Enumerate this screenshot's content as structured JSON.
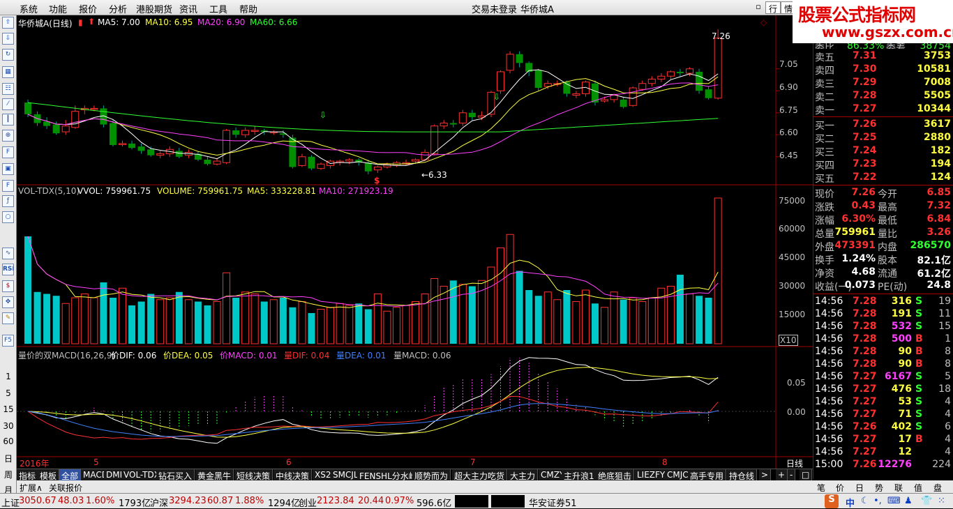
{
  "menu": {
    "items": [
      "系统",
      "功能",
      "报价",
      "分析",
      "港股期货",
      "资讯",
      "工具",
      "帮助"
    ],
    "center_status": "交易未登录",
    "center_stock": "华侨城A",
    "tab_hang": "行",
    "tab_qing": "情"
  },
  "logo": {
    "line1": "股票公式指标网",
    "line2": "www.gszx.com.cn"
  },
  "left_tools": {
    "icon_names": [
      "arrow-up-icon",
      "arrow-down-icon",
      "refresh-icon",
      "grid-icon",
      "table-icon",
      "line-chart-icon",
      "kline-icon",
      "zoom-icon",
      "fio-icon",
      "image-icon",
      "f10-icon",
      "f-lambda-icon",
      "circle-icon",
      "wave-icon",
      "rsi-icon",
      "dollar-icon",
      "move-icon",
      "pencil-icon",
      "f5-icon"
    ],
    "rsi_label": "RSI",
    "f5_label": "F5",
    "periods": [
      "1",
      "5",
      "15",
      "30",
      "60",
      "日",
      "周",
      "月"
    ]
  },
  "main_panel": {
    "stock_label": "华侨城A(日线)",
    "ma5": "MA5: 7.00",
    "ma10": "MA10: 6.95",
    "ma20": "MA20: 6.90",
    "ma60": "MA60: 6.66",
    "y_ticks": [
      "7.05",
      "6.90",
      "6.75",
      "6.60",
      "6.45"
    ],
    "high_mark": "7.26",
    "low_mark": "←6.33",
    "dollar_mark": "$"
  },
  "vol_panel": {
    "label": "VOL-TDX(5,10)",
    "vvol": "VVOL: 759961.75",
    "volume": "VOLUME: 759961.75",
    "ma5": "MA5: 333228.81",
    "ma10": "MA10: 271923.19",
    "y_ticks": [
      "75000",
      "60000",
      "45000",
      "30000",
      "15000"
    ],
    "unit": "X10"
  },
  "macd_panel": {
    "label": "量价的双MACD(16,26,9)",
    "dif": "价DIF: 0.06",
    "dea": "价DEA: 0.05",
    "macd": "价MACD: 0.01",
    "qdif": "量DIF: 0.04",
    "qdea": "量DEA: 0.01",
    "qmacd": "量MACD: 0.06",
    "y_ticks": [
      "0.05",
      "0.00"
    ]
  },
  "time_axis": {
    "year": "2016年",
    "months": [
      "5",
      "6",
      "7",
      "8"
    ],
    "period": "日线"
  },
  "bottom_tabs": [
    "指标",
    "模板",
    "全部",
    "MACD",
    "DMI",
    "VOL-TDX",
    "钻石买入",
    "黄金黑牛",
    "短线决策",
    "中线决策",
    "XS2",
    "SMCJL",
    "FENSHL分水岭",
    "顺势而为",
    "超大主力吃货",
    "大主力",
    "CMZY",
    "主升浪1",
    "绝底狙击",
    "LIEZFY",
    "CMJC",
    "高手专用",
    "持仓线"
  ],
  "bottom_tab_more": ">",
  "bottom_tab_controls": [
    "+",
    "-",
    "□"
  ],
  "tabs2": [
    "扩展∧",
    "关联报价"
  ],
  "right": {
    "partial_row": {
      "a": "委比",
      "b": "86.33%",
      "c": "委差",
      "d": "38754"
    },
    "asks": [
      {
        "label": "卖五",
        "price": "7.31",
        "vol": "3753"
      },
      {
        "label": "卖四",
        "price": "7.30",
        "vol": "10581"
      },
      {
        "label": "卖三",
        "price": "7.29",
        "vol": "7008"
      },
      {
        "label": "卖二",
        "price": "7.28",
        "vol": "5505"
      },
      {
        "label": "卖一",
        "price": "7.27",
        "vol": "10344"
      }
    ],
    "bids": [
      {
        "label": "买一",
        "price": "7.26",
        "vol": "3617"
      },
      {
        "label": "买二",
        "price": "7.25",
        "vol": "2880"
      },
      {
        "label": "买三",
        "price": "7.24",
        "vol": "182"
      },
      {
        "label": "买四",
        "price": "7.23",
        "vol": "194"
      },
      {
        "label": "买五",
        "price": "7.22",
        "vol": "124"
      }
    ],
    "stats": [
      {
        "l1": "现价",
        "v1": "7.26",
        "l2": "今开",
        "v2": "6.85",
        "c1": "#ff3030",
        "c2": "#ff3030"
      },
      {
        "l1": "涨跌",
        "v1": "0.43",
        "l2": "最高",
        "v2": "7.32",
        "c1": "#ff3030",
        "c2": "#ff3030"
      },
      {
        "l1": "涨幅",
        "v1": "6.30%",
        "l2": "最低",
        "v2": "6.84",
        "c1": "#ff3030",
        "c2": "#ff3030"
      },
      {
        "l1": "总量",
        "v1": "759961",
        "l2": "量比",
        "v2": "3.26",
        "c1": "#ffff40",
        "c2": "#ff3030"
      },
      {
        "l1": "外盘",
        "v1": "473391",
        "l2": "内盘",
        "v2": "286570",
        "c1": "#ff3030",
        "c2": "#30ff30"
      },
      {
        "l1": "换手",
        "v1": "1.24%",
        "l2": "股本",
        "v2": "82.1亿",
        "c1": "#ffffff",
        "c2": "#ffffff"
      },
      {
        "l1": "净资",
        "v1": "4.68",
        "l2": "流通",
        "v2": "61.2亿",
        "c1": "#ffffff",
        "c2": "#ffffff"
      },
      {
        "l1": "收益(一)",
        "v1": "0.073",
        "l2": "PE(动)",
        "v2": "24.8",
        "c1": "#ffffff",
        "c2": "#ffffff"
      }
    ],
    "ticks": [
      {
        "t": "14:56",
        "p": "7.28",
        "v": "316",
        "s": "S",
        "n": "19",
        "pc": "#ff3030",
        "vc": "#ffff40",
        "sc": "#30ff30"
      },
      {
        "t": "14:56",
        "p": "7.28",
        "v": "191",
        "s": "S",
        "n": "11",
        "pc": "#ff3030",
        "vc": "#ffff40",
        "sc": "#30ff30"
      },
      {
        "t": "14:56",
        "p": "7.28",
        "v": "532",
        "s": "S",
        "n": "15",
        "pc": "#ff3030",
        "vc": "#ff40ff",
        "sc": "#30ff30"
      },
      {
        "t": "14:56",
        "p": "7.28",
        "v": "500",
        "s": "B",
        "n": "1",
        "pc": "#ff3030",
        "vc": "#ff40ff",
        "sc": "#ff3030"
      },
      {
        "t": "14:56",
        "p": "7.28",
        "v": "90",
        "s": "B",
        "n": "8",
        "pc": "#ff3030",
        "vc": "#ffff40",
        "sc": "#ff3030"
      },
      {
        "t": "14:56",
        "p": "7.28",
        "v": "90",
        "s": "B",
        "n": "8",
        "pc": "#ff3030",
        "vc": "#ffff40",
        "sc": "#ff3030"
      },
      {
        "t": "14:56",
        "p": "7.27",
        "v": "6167",
        "s": "S",
        "n": "5",
        "pc": "#ff3030",
        "vc": "#ff40ff",
        "sc": "#30ff30"
      },
      {
        "t": "14:56",
        "p": "7.27",
        "v": "476",
        "s": "S",
        "n": "18",
        "pc": "#ff3030",
        "vc": "#ffff40",
        "sc": "#30ff30"
      },
      {
        "t": "14:56",
        "p": "7.27",
        "v": "53",
        "s": "S",
        "n": "4",
        "pc": "#ff3030",
        "vc": "#ffff40",
        "sc": "#30ff30"
      },
      {
        "t": "14:56",
        "p": "7.27",
        "v": "71",
        "s": "S",
        "n": "4",
        "pc": "#ff3030",
        "vc": "#ffff40",
        "sc": "#30ff30"
      },
      {
        "t": "14:56",
        "p": "7.26",
        "v": "402",
        "s": "S",
        "n": "6",
        "pc": "#ff3030",
        "vc": "#ffff40",
        "sc": "#30ff30"
      },
      {
        "t": "14:56",
        "p": "7.27",
        "v": "17",
        "s": "B",
        "n": "4",
        "pc": "#ff3030",
        "vc": "#ffff40",
        "sc": "#ff3030"
      },
      {
        "t": "14:56",
        "p": "7.27",
        "v": "12",
        "s": "",
        "n": "4",
        "pc": "#ff3030",
        "vc": "#ffff40",
        "sc": "#ff3030"
      },
      {
        "t": "15:00",
        "p": "7.26",
        "v": "12276",
        "s": "",
        "n": "224",
        "pc": "#ff3030",
        "vc": "#ff40ff",
        "sc": "#ff3030"
      }
    ],
    "tabs": [
      "笔",
      "价",
      "日",
      "势",
      "联",
      "值",
      "盘"
    ]
  },
  "status": {
    "sh_label": "上证",
    "sh_val": "3050.67",
    "sh_chg": "48.03",
    "sh_pct": "1.60%",
    "sh_amt": "1793亿",
    "sz_label": "沪深",
    "sz_val": "3294.23",
    "sz_chg": "60.87",
    "sz_pct": "1.88%",
    "sz_amt": "1294亿",
    "cy_label": "创业",
    "cy_val": "2123.84",
    "cy_chg": "20.44",
    "cy_pct": "0.97%",
    "cy_amt": "596.6亿",
    "broker": "华安证券51",
    "ime": "中"
  },
  "colors": {
    "up": "#ff3030",
    "down": "#00c8c8",
    "down_candle": "#00a000",
    "ma5": "#ffffff",
    "ma10": "#ffff40",
    "ma20": "#ff40ff",
    "ma60": "#30ff30"
  },
  "chart_data": {
    "type": "candlestick",
    "ylim": [
      6.33,
      7.32
    ],
    "candles": [
      [
        6.82,
        6.74,
        6.84,
        6.72
      ],
      [
        6.74,
        6.68,
        6.76,
        6.66
      ],
      [
        6.69,
        6.66,
        6.72,
        6.64
      ],
      [
        6.67,
        6.61,
        6.69,
        6.6
      ],
      [
        6.62,
        6.66,
        6.7,
        6.6
      ],
      [
        6.65,
        6.76,
        6.8,
        6.64
      ],
      [
        6.77,
        6.78,
        6.8,
        6.74
      ],
      [
        6.78,
        6.78,
        6.8,
        6.76
      ],
      [
        6.78,
        6.67,
        6.8,
        6.65
      ],
      [
        6.68,
        6.53,
        6.7,
        6.52
      ],
      [
        6.54,
        6.54,
        6.56,
        6.52
      ],
      [
        6.54,
        6.51,
        6.56,
        6.5
      ],
      [
        6.52,
        6.49,
        6.54,
        6.47
      ],
      [
        6.5,
        6.46,
        6.52,
        6.45
      ],
      [
        6.46,
        6.47,
        6.49,
        6.44
      ],
      [
        6.47,
        6.5,
        6.52,
        6.45
      ],
      [
        6.49,
        6.45,
        6.51,
        6.44
      ],
      [
        6.46,
        6.48,
        6.5,
        6.44
      ],
      [
        6.47,
        6.43,
        6.49,
        6.42
      ],
      [
        6.43,
        6.4,
        6.45,
        6.39
      ],
      [
        6.4,
        6.42,
        6.44,
        6.39
      ],
      [
        6.41,
        6.63,
        6.64,
        6.4
      ],
      [
        6.63,
        6.6,
        6.65,
        6.58
      ],
      [
        6.6,
        6.63,
        6.65,
        6.58
      ],
      [
        6.63,
        6.63,
        6.66,
        6.6
      ],
      [
        6.63,
        6.62,
        6.64,
        6.6
      ],
      [
        6.62,
        6.62,
        6.63,
        6.6
      ],
      [
        6.61,
        6.6,
        6.63,
        6.58
      ],
      [
        6.58,
        6.38,
        6.6,
        6.37
      ],
      [
        6.39,
        6.45,
        6.47,
        6.38
      ],
      [
        6.45,
        6.37,
        6.46,
        6.36
      ],
      [
        6.37,
        6.4,
        6.41,
        6.36
      ],
      [
        6.39,
        6.42,
        6.43,
        6.37
      ],
      [
        6.41,
        6.42,
        6.43,
        6.39
      ],
      [
        6.42,
        6.43,
        6.44,
        6.4
      ],
      [
        6.43,
        6.41,
        6.44,
        6.39
      ],
      [
        6.41,
        6.35,
        6.43,
        6.33
      ],
      [
        6.36,
        6.38,
        6.39,
        6.34
      ],
      [
        6.38,
        6.4,
        6.41,
        6.37
      ],
      [
        6.39,
        6.41,
        6.42,
        6.38
      ],
      [
        6.4,
        6.41,
        6.43,
        6.39
      ],
      [
        6.42,
        6.43,
        6.44,
        6.4
      ],
      [
        6.43,
        6.48,
        6.5,
        6.42
      ],
      [
        6.47,
        6.66,
        6.67,
        6.46
      ],
      [
        6.66,
        6.68,
        6.7,
        6.64
      ],
      [
        6.68,
        6.67,
        6.7,
        6.65
      ],
      [
        6.68,
        6.75,
        6.77,
        6.66
      ],
      [
        6.75,
        6.72,
        6.77,
        6.7
      ],
      [
        6.72,
        6.73,
        6.76,
        6.7
      ],
      [
        6.74,
        6.89,
        6.9,
        6.72
      ],
      [
        6.9,
        7.03,
        7.04,
        6.88
      ],
      [
        7.04,
        7.15,
        7.17,
        7.02
      ],
      [
        7.15,
        7.09,
        7.17,
        7.06
      ],
      [
        7.09,
        7.03,
        7.1,
        7.0
      ],
      [
        7.04,
        6.92,
        7.05,
        6.9
      ],
      [
        6.93,
        6.95,
        6.97,
        6.91
      ],
      [
        6.95,
        6.95,
        6.97,
        6.93
      ],
      [
        6.96,
        6.88,
        6.97,
        6.86
      ],
      [
        6.87,
        6.88,
        6.9,
        6.85
      ],
      [
        6.88,
        6.96,
        6.97,
        6.86
      ],
      [
        6.95,
        6.82,
        6.97,
        6.8
      ],
      [
        6.83,
        6.84,
        6.86,
        6.82
      ],
      [
        6.84,
        6.87,
        6.88,
        6.82
      ],
      [
        6.84,
        6.79,
        6.86,
        6.78
      ],
      [
        6.8,
        6.92,
        6.93,
        6.79
      ],
      [
        6.91,
        6.95,
        6.97,
        6.9
      ],
      [
        6.95,
        6.98,
        7.0,
        6.93
      ],
      [
        6.98,
        7.0,
        7.02,
        6.96
      ],
      [
        7.0,
        7.03,
        7.04,
        6.98
      ],
      [
        7.03,
        7.02,
        7.05,
        7.0
      ],
      [
        7.02,
        7.05,
        7.06,
        7.0
      ],
      [
        7.03,
        6.9,
        7.05,
        6.88
      ],
      [
        6.91,
        6.85,
        6.93,
        6.84
      ],
      [
        6.85,
        7.26,
        7.32,
        6.84
      ]
    ],
    "volumes": [
      56000,
      27000,
      26000,
      25000,
      21000,
      24000,
      26000,
      24000,
      32000,
      24000,
      29000,
      20000,
      22000,
      26000,
      23000,
      24000,
      27000,
      23000,
      22000,
      20000,
      22000,
      37000,
      24000,
      27000,
      26000,
      22000,
      23000,
      24000,
      19000,
      22000,
      16000,
      18000,
      19000,
      21000,
      20000,
      21000,
      18000,
      26000,
      17000,
      19000,
      20000,
      22000,
      26000,
      34000,
      30000,
      33000,
      31000,
      30000,
      33000,
      40000,
      50000,
      57000,
      38000,
      28000,
      25000,
      27000,
      23000,
      28000,
      22000,
      28000,
      21000,
      19000,
      27000,
      23000,
      24000,
      22000,
      24000,
      29000,
      30000,
      36000,
      26000,
      25000,
      24000,
      76000
    ]
  }
}
